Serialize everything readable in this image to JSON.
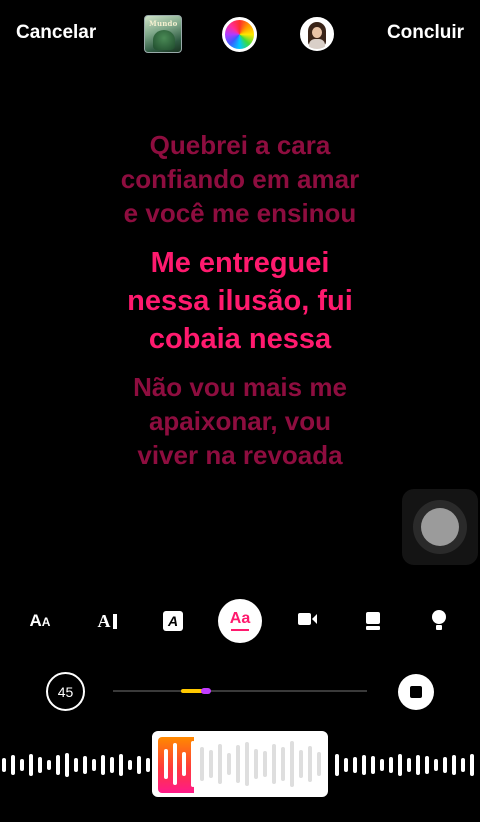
{
  "topbar": {
    "cancel_label": "Cancelar",
    "done_label": "Concluir",
    "album_icon": "album-cover-thumbnail",
    "color_icon": "color-wheel-icon",
    "avatar_icon": "profile-avatar"
  },
  "lyrics": {
    "previous": [
      "Quebrei a cara",
      "confiando em amar",
      "e você me ensinou"
    ],
    "current": [
      "Me entreguei",
      "nessa ilusão, fui",
      "cobaia nessa"
    ],
    "next": [
      "Não vou mais me",
      "apaixonar, vou",
      "viver na revoada"
    ]
  },
  "toolbar": {
    "font_size_label": "AA",
    "text_style_label": "A",
    "box_style_label": "A",
    "active_style_label": "Aa",
    "accent_color": "#ff1a6e"
  },
  "playback": {
    "duration_label": "45",
    "stop_icon": "stop-icon"
  },
  "colors": {
    "lyric_dim": "#8e0d3f",
    "lyric_active": "#ff1a6e",
    "progress": "#ffc800",
    "progress_marker": "#c23cff"
  }
}
